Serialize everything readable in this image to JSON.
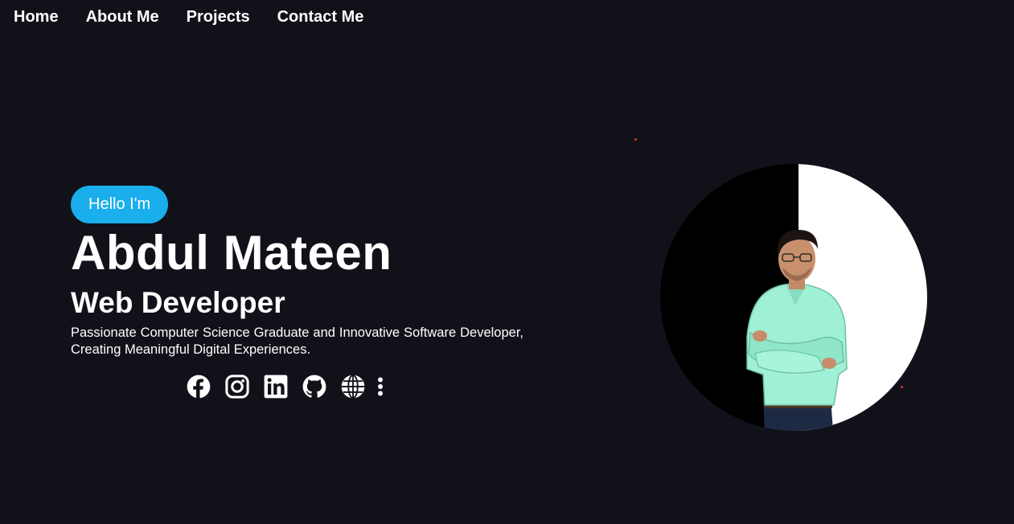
{
  "nav": {
    "items": [
      {
        "label": "Home"
      },
      {
        "label": "About Me"
      },
      {
        "label": "Projects"
      },
      {
        "label": "Contact Me"
      }
    ]
  },
  "hero": {
    "greeting": "Hello I'm",
    "name": "Abdul Mateen",
    "role": "Web Developer",
    "description": "Passionate Computer Science Graduate and Innovative Software Developer, Creating Meaningful Digital Experiences."
  },
  "socials": [
    {
      "icon": "facebook-icon"
    },
    {
      "icon": "instagram-icon"
    },
    {
      "icon": "linkedin-icon"
    },
    {
      "icon": "github-icon"
    },
    {
      "icon": "globe-icon"
    },
    {
      "icon": "more-vertical-icon"
    }
  ],
  "colors": {
    "background": "#11111a",
    "accent": "#1aaeec",
    "text": "#ffffff",
    "spark": "#e0301e"
  }
}
